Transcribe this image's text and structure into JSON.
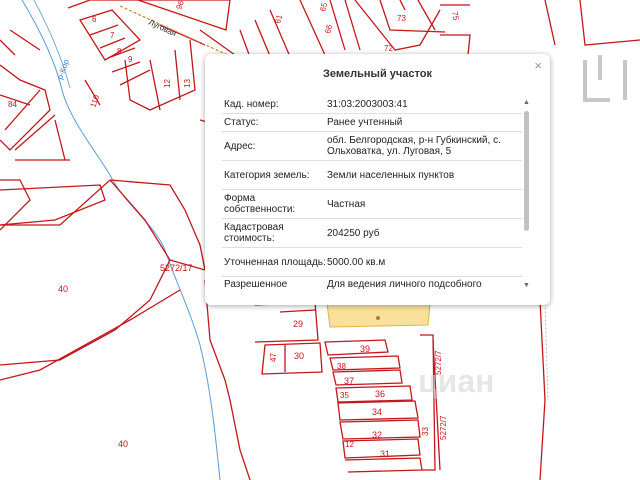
{
  "map": {
    "river_label": "р-Кор",
    "labels": {
      "p96": "96",
      "p6": "6",
      "p7": "7",
      "p8": "8",
      "p9": "9",
      "p110": "110",
      "p84": "84",
      "p12": "12",
      "p13": "13",
      "p19": "19",
      "p61": "61",
      "p65": "65",
      "p66": "66",
      "p73": "73",
      "p75": "75",
      "p72": "72",
      "p40a": "40",
      "p40b": "40",
      "p5272_17": "5272/17",
      "p29": "29",
      "p47": "47",
      "p30": "30",
      "p39": "39",
      "p38": "38",
      "p37": "37",
      "p36": "36",
      "p34": "34",
      "p32": "32",
      "p33": "33",
      "p31": "31",
      "p35": "35",
      "p12b": "12",
      "p5272_7": "5272/7"
    },
    "street_label": "Луговая",
    "watermark": "циан"
  },
  "popup": {
    "title": "Земельный участок",
    "close": "×",
    "rows": [
      {
        "k": "Кад. номер:",
        "v": "31:03:2003003:41"
      },
      {
        "k": "Статус:",
        "v": "Ранее учтенный"
      },
      {
        "k": "Адрес:",
        "v": "обл. Белгородская, р-н Губкинский, с. Ольховатка, ул. Луговая, 5"
      },
      {
        "k": "Категория земель:",
        "v": "Земли населенных пунктов"
      },
      {
        "k": "Форма собственности:",
        "v": "Частная"
      },
      {
        "k": "Кадастровая стоимость:",
        "v": "204250 руб"
      },
      {
        "k": "Уточненная площадь:",
        "v": "5000.00 кв.м"
      },
      {
        "k": "Разрешенное",
        "v": "Для ведения личного подсобного"
      }
    ]
  },
  "colors": {
    "parcel_line": "#c4161c",
    "river": "#5b9bd5",
    "selected_fill": "#f7d77a"
  }
}
